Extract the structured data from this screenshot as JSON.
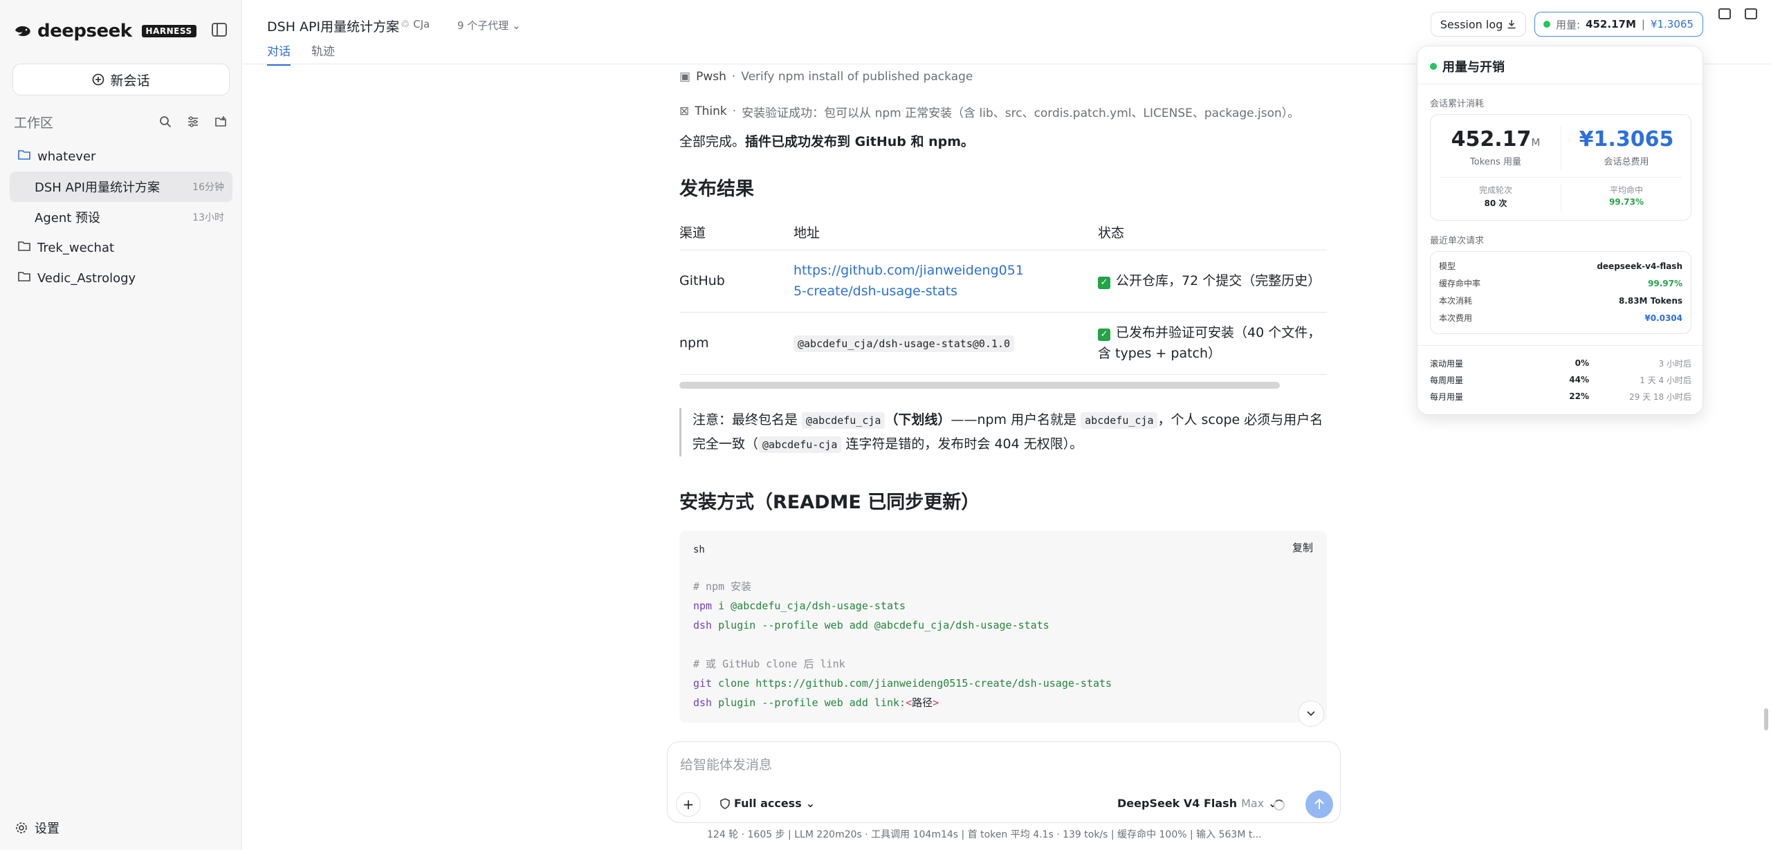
{
  "sidebar": {
    "brand": "deepseek",
    "badge": "HARNESS",
    "new_chat": "新会话",
    "workspace_label": "工作区",
    "tree": [
      {
        "label": "whatever",
        "type": "folder",
        "open": true
      },
      {
        "label": "DSH API用量统计方案",
        "time": "16分钟",
        "type": "chat",
        "active": true
      },
      {
        "label": "Agent 预设",
        "time": "13小时",
        "type": "chat"
      },
      {
        "label": "Trek_wechat",
        "type": "folder"
      },
      {
        "label": "Vedic_Astrology",
        "type": "folder"
      }
    ],
    "settings": "设置"
  },
  "header": {
    "title": "DSH API用量统计方案",
    "user": "CJa",
    "agents": "9 个子代理",
    "tabs": [
      "对话",
      "轨迹"
    ],
    "session_log": "Session log",
    "usage_label": "用量:",
    "usage_tokens": "452.17M",
    "usage_cost": "¥1.3065"
  },
  "content": {
    "step1_kind": "Pwsh",
    "step1_text": "Verify npm install of published package",
    "step2_kind": "Think",
    "step2_text": "安装验证成功：包可以从 npm 正常安装（含 lib、src、cordis.patch.yml、LICENSE、package.json）。",
    "done_prefix": "全部完成。",
    "done_bold": "插件已成功发布到 GitHub 和 npm。",
    "h_results": "发布结果",
    "table": {
      "headers": [
        "渠道",
        "地址",
        "状态"
      ],
      "rows": [
        {
          "channel": "GitHub",
          "address": "https://github.com/jianweideng0515-create/dsh-usage-stats",
          "status": "公开仓库，72 个提交（完整历史）"
        },
        {
          "channel": "npm",
          "address": "@abcdefu_cja/dsh-usage-stats@0.1.0",
          "status": "已发布并验证可安装（40 个文件，含 types + patch）"
        }
      ]
    },
    "note": {
      "t1": "注意：最终包名是 ",
      "c1": "@abcdefu_cja",
      "b1": "（下划线）",
      "t2": "——npm 用户名就是 ",
      "c2": "abcdefu_cja",
      "t3": "，个人 scope 必须与用户名完全一致（",
      "c3": "@abcdefu-cja",
      "t4": " 连字符是错的，发布时会 404 无权限）。"
    },
    "h_install": "安装方式（README 已同步更新）",
    "code": {
      "lang": "sh",
      "copy": "复制",
      "c1": "# npm 安装",
      "l1a": "npm",
      "l1b": " i @abcdefu_cja/dsh-usage-stats",
      "l2a": "dsh",
      "l2b": " plugin --profile web add @abcdefu_cja/dsh-usage-stats",
      "c2": "# 或 GitHub clone 后 link",
      "l3a": "git",
      "l3b": " clone https://github.com/jianweideng0515-create/dsh-usage-stats",
      "l4a": "dsh",
      "l4b": " plugin --profile web add link:",
      "l4c": "<",
      "l4d": "路径",
      "l4e": ">"
    }
  },
  "composer": {
    "placeholder": "给智能体发消息",
    "access": "Full access",
    "model": "DeepSeek V4 Flash",
    "mode": "Max"
  },
  "footer": {
    "stats": "124 轮 · 1605 步   |   LLM 220m20s · 工具调用 104m14s   |   首 token 平均 4.1s · 139 tok/s   |   缓存命中 100%   |   输入 563M t..."
  },
  "usage_panel": {
    "title": "用量与开销",
    "session_label": "会话累计消耗",
    "tokens": "452.17",
    "tokens_unit": "M",
    "tokens_label": "Tokens 用量",
    "cost": "¥1.3065",
    "cost_label": "会话总费用",
    "rounds_label": "完成轮次",
    "rounds": "80 次",
    "hit_label": "平均命中",
    "hit": "99.73%",
    "recent_label": "最近单次请求",
    "recent": [
      {
        "k": "模型",
        "v": "deepseek-v4-flash"
      },
      {
        "k": "缓存命中率",
        "v": "99.97%"
      },
      {
        "k": "本次消耗",
        "v": "8.83M Tokens"
      },
      {
        "k": "本次费用",
        "v": "¥0.0304"
      }
    ],
    "limits": [
      {
        "k": "滚动用量",
        "p": "0%",
        "t": "3 小时后"
      },
      {
        "k": "每周用量",
        "p": "44%",
        "t": "1 天 4 小时后"
      },
      {
        "k": "每月用量",
        "p": "22%",
        "t": "29 天 18 小时后"
      }
    ]
  }
}
